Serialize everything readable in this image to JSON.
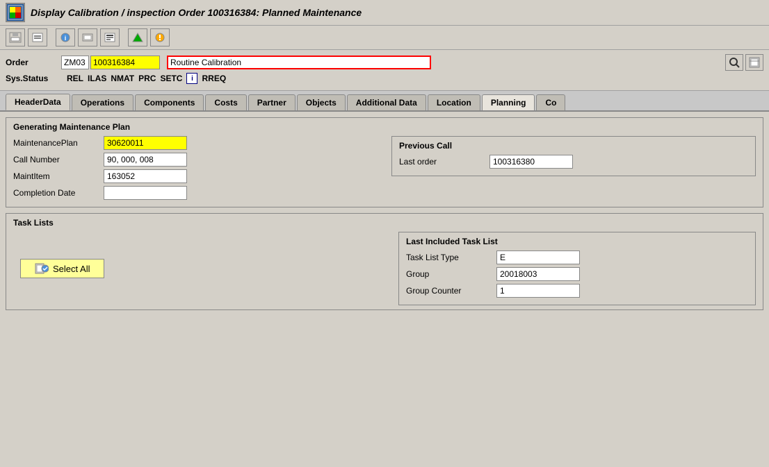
{
  "title": "Display Calibration / inspection Order 100316384: Planned Maintenance",
  "toolbar": {
    "buttons": [
      "💾",
      "🖨",
      "📋",
      "📄",
      "📊",
      "🔧",
      "📌"
    ]
  },
  "order_form": {
    "order_label": "Order",
    "order_type": "ZM03",
    "order_number": "100316384",
    "order_desc": "Routine Calibration",
    "sys_status_label": "Sys.Status",
    "status_items": [
      "REL",
      "ILAS",
      "NMAT",
      "PRC",
      "SETC"
    ],
    "rreq": "RREQ"
  },
  "tabs": [
    {
      "id": "header-data",
      "label": "HeaderData"
    },
    {
      "id": "operations",
      "label": "Operations"
    },
    {
      "id": "components",
      "label": "Components"
    },
    {
      "id": "costs",
      "label": "Costs"
    },
    {
      "id": "partner",
      "label": "Partner"
    },
    {
      "id": "objects",
      "label": "Objects"
    },
    {
      "id": "additional-data",
      "label": "Additional Data"
    },
    {
      "id": "location",
      "label": "Location"
    },
    {
      "id": "planning",
      "label": "Planning"
    },
    {
      "id": "more",
      "label": "Co"
    }
  ],
  "active_tab": "planning",
  "generating_section": {
    "title": "Generating Maintenance Plan",
    "maintenance_plan_label": "MaintenancePlan",
    "maintenance_plan_value": "30620011",
    "call_number_label": "Call Number",
    "call_number_value": "90, 000, 008",
    "maint_item_label": "MaintItem",
    "maint_item_value": "163052",
    "completion_date_label": "Completion Date",
    "completion_date_value": ""
  },
  "previous_call": {
    "title": "Previous Call",
    "last_order_label": "Last order",
    "last_order_value": "100316380"
  },
  "task_lists": {
    "title": "Task Lists",
    "select_all_label": "Select All",
    "last_included": {
      "title": "Last Included Task List",
      "task_list_type_label": "Task List Type",
      "task_list_type_value": "E",
      "group_label": "Group",
      "group_value": "20018003",
      "group_counter_label": "Group Counter",
      "group_counter_value": "1"
    }
  }
}
